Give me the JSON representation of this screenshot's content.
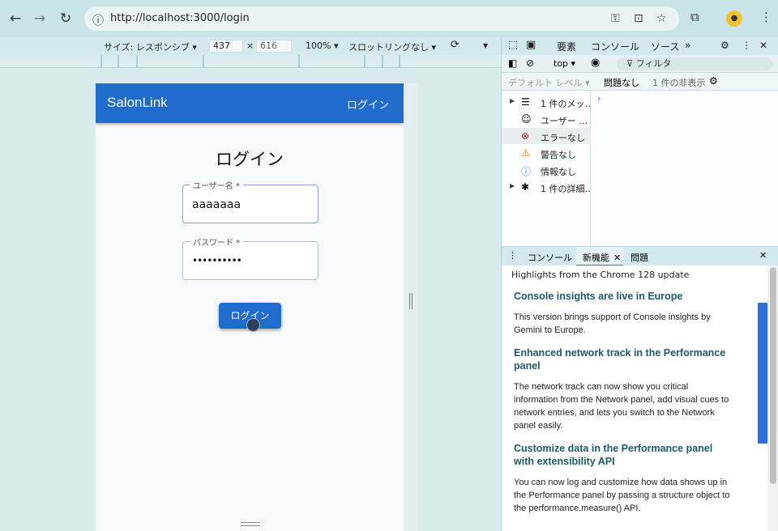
{
  "browser": {
    "url": "http://localhost:3000/login",
    "nav_icons": [
      "back-arrow",
      "forward-arrow",
      "reload"
    ],
    "toolbar_icons": [
      "key",
      "install-app",
      "bookmark-star",
      "extensions",
      "profile",
      "menu-kebab"
    ]
  },
  "device_toolbar": {
    "size_label": "サイズ: レスポンシブ ▾",
    "width": "437",
    "times": "×",
    "height": "616",
    "zoom": "100% ▾",
    "throttle": "スロットリングなし ▾"
  },
  "app": {
    "title": "SalonLink",
    "nav_login": "ログイン",
    "heading": "ログイン",
    "username_label": "ユーザー名 *",
    "username_value": "aaaaaaa",
    "password_label": "パスワード *",
    "password_value": "••••••••••",
    "submit_label": "ログイン"
  },
  "devtools": {
    "tabs": [
      "要素",
      "コンソール",
      "ソース"
    ],
    "context": "top ▾",
    "filter_placeholder": "フィルタ",
    "default_levels": "デフォルト レベル ▾",
    "no_issues": "問題なし",
    "hidden_count": "1 件の非表示",
    "sidebar": [
      {
        "label": "1 件のメッ…",
        "icon": "list-icon",
        "tri": "▶"
      },
      {
        "label": "ユーザー …",
        "icon": "user-icon",
        "tri": ""
      },
      {
        "label": "エラーなし",
        "icon": "error-icon",
        "tri": ""
      },
      {
        "label": "警告なし",
        "icon": "warning-icon",
        "tri": ""
      },
      {
        "label": "情報なし",
        "icon": "info-icon",
        "tri": ""
      },
      {
        "label": "1 件の詳細…",
        "icon": "bug-icon",
        "tri": "▶"
      }
    ],
    "drawer_tabs": [
      "コンソール",
      "新機能",
      "問題"
    ],
    "highlights": "Highlights from the Chrome 128 update",
    "whatsnew": [
      {
        "heading": "Console insights are live in Europe",
        "body": "This version brings support of Console insights by Gemini to Europe."
      },
      {
        "heading": "Enhanced network track in the Performance panel",
        "body": "The network track can now show you critical information from the Network panel, add visual cues to network entries, and lets you switch to the Network panel easily."
      },
      {
        "heading": "Customize data in the Performance panel with extensibility API",
        "body": "You can now log and customize how data shows up in the Performance panel by passing a structure object to the performance.measure() API."
      }
    ]
  }
}
